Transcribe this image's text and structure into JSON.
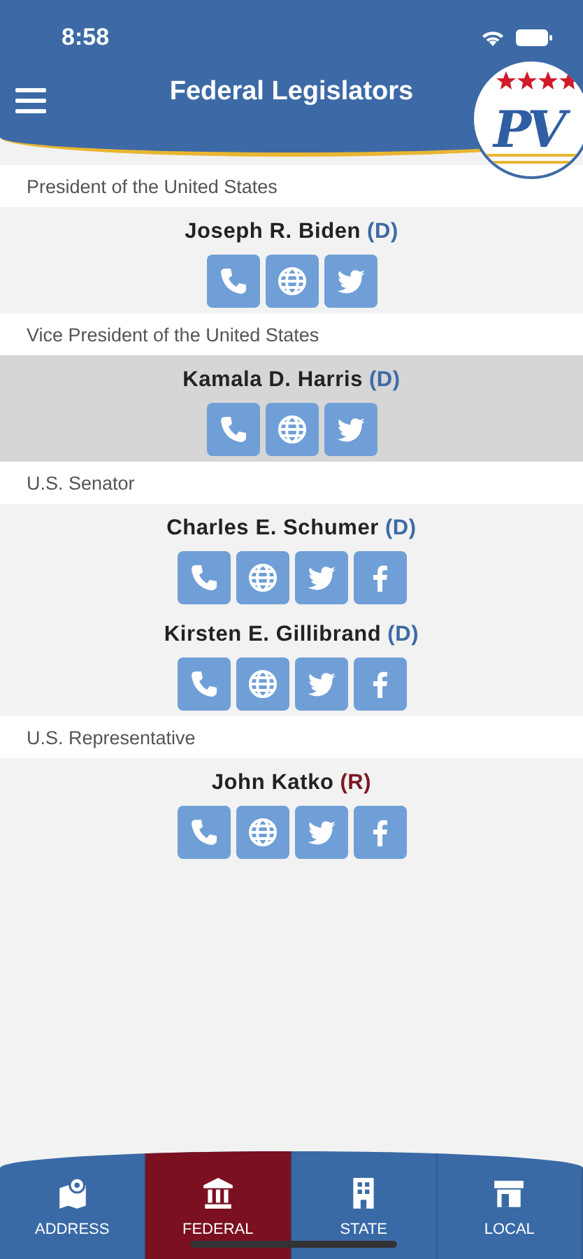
{
  "status_bar": {
    "time": "8:58"
  },
  "header": {
    "title": "Federal Legislators",
    "logo_text": "PV"
  },
  "sections": [
    {
      "title": "President of the United States",
      "members": [
        {
          "name": "Joseph R. Biden",
          "party": "(D)",
          "color": "#3d6aa6",
          "selected": false,
          "links": [
            {
              "kind": "phone"
            },
            {
              "kind": "web"
            },
            {
              "kind": "twitter"
            }
          ]
        }
      ]
    },
    {
      "title": "Vice President of the United States",
      "members": [
        {
          "name": "Kamala D. Harris",
          "party": "(D)",
          "color": "#3d6aa6",
          "selected": true,
          "links": [
            {
              "kind": "phone"
            },
            {
              "kind": "web"
            },
            {
              "kind": "twitter"
            }
          ]
        }
      ]
    },
    {
      "title": "U.S. Senator",
      "members": [
        {
          "name": "Charles E. Schumer",
          "party": "(D)",
          "color": "#3d6aa6",
          "selected": false,
          "links": [
            {
              "kind": "phone"
            },
            {
              "kind": "web"
            },
            {
              "kind": "twitter"
            },
            {
              "kind": "facebook"
            }
          ]
        },
        {
          "name": "Kirsten E. Gillibrand",
          "party": "(D)",
          "color": "#3d6aa6",
          "selected": false,
          "links": [
            {
              "kind": "phone"
            },
            {
              "kind": "web"
            },
            {
              "kind": "twitter"
            },
            {
              "kind": "facebook"
            }
          ]
        }
      ]
    },
    {
      "title": "U.S. Representative",
      "members": [
        {
          "name": "John Katko",
          "party": "(R)",
          "color": "#7a1a24",
          "selected": false,
          "links": [
            {
              "kind": "phone"
            },
            {
              "kind": "web"
            },
            {
              "kind": "twitter"
            },
            {
              "kind": "facebook"
            }
          ]
        }
      ]
    }
  ],
  "tabs": [
    {
      "label": "ADDRESS",
      "kind": "map",
      "selected": false
    },
    {
      "label": "FEDERAL",
      "kind": "capitol",
      "selected": true
    },
    {
      "label": "STATE",
      "kind": "building",
      "selected": false
    },
    {
      "label": "LOCAL",
      "kind": "store",
      "selected": false
    }
  ]
}
